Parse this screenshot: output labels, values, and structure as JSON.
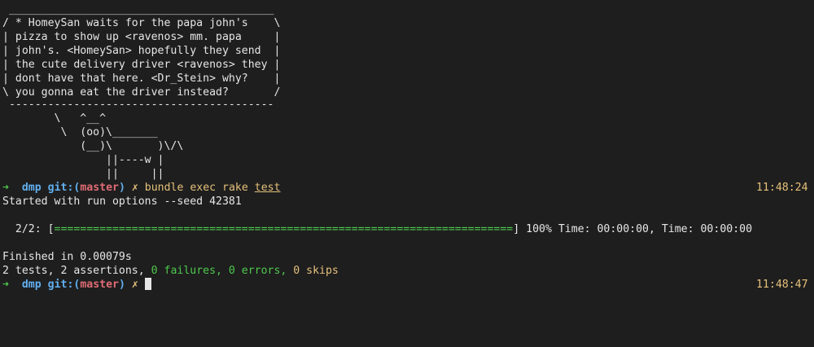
{
  "cowsay": {
    "lines": [
      " _________________________________________",
      "/ * HomeySan waits for the papa john's    \\",
      "| pizza to show up <ravenos> mm. papa     |",
      "| john's. <HomeySan> hopefully they send  |",
      "| the cute delivery driver <ravenos> they |",
      "| dont have that here. <Dr_Stein> why?    |",
      "\\ you gonna eat the driver instead?       /",
      " -----------------------------------------",
      "        \\   ^__^",
      "         \\  (oo)\\_______",
      "            (__)\\       )\\/\\",
      "                ||----w |",
      "                ||     ||"
    ]
  },
  "prompt1": {
    "arrow": "➜",
    "dir": "dmp",
    "git_prefix": "git:(",
    "branch": "master",
    "git_suffix": ")",
    "dirty": "✗",
    "cmd": "bundle exec rake",
    "cmd_arg": "test",
    "time": "11:48:24"
  },
  "output": {
    "started": "Started with run options --seed 42381",
    "progress_label": "  2/2: [",
    "progress_bar": "=======================================================================",
    "progress_end": "] 100% Time: 00:00:00, Time: 00:00:00",
    "progress_value": 1.0,
    "finished": "Finished in 0.00079s",
    "summary_tests": "2 tests, 2 assertions, ",
    "summary_failures": "0 failures, 0 errors, ",
    "summary_skips": "0 skips"
  },
  "prompt2": {
    "arrow": "➜",
    "dir": "dmp",
    "git_prefix": "git:(",
    "branch": "master",
    "git_suffix": ")",
    "dirty": "✗",
    "time": "11:48:47"
  },
  "colors": {
    "background": "#1e1e1e",
    "foreground": "#e6e6e6",
    "green": "#4ec94e",
    "blue": "#61afef",
    "red": "#e06c75",
    "yellow": "#e5c07b"
  }
}
